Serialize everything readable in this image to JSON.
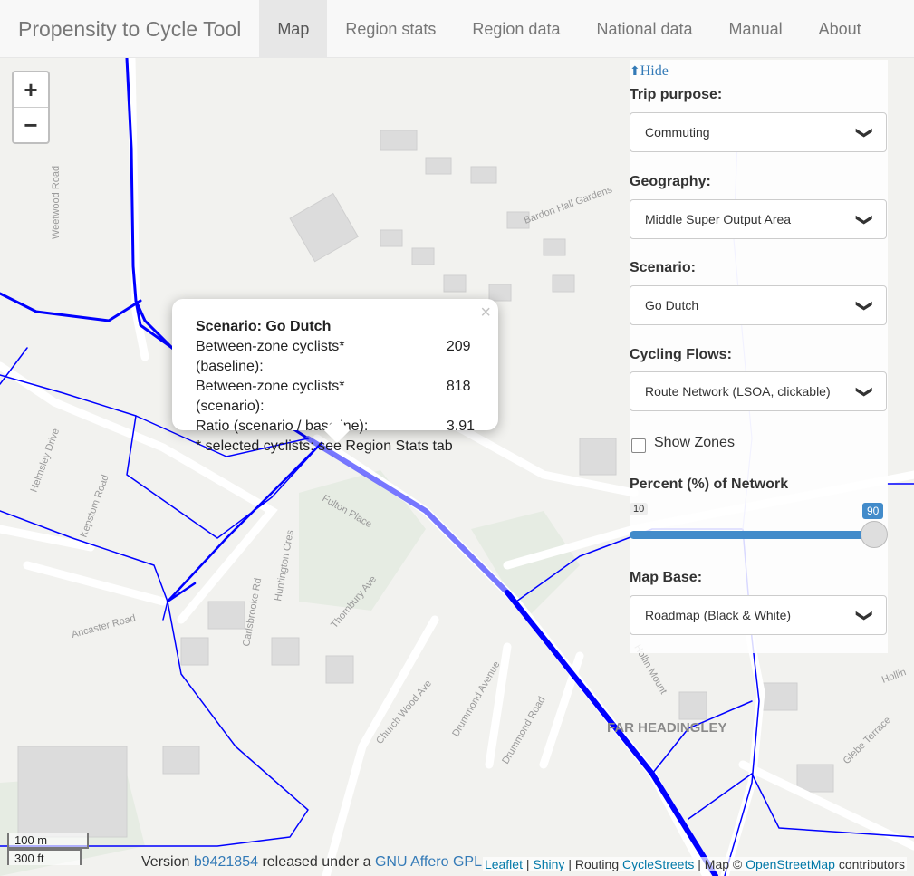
{
  "brand": "Propensity to Cycle Tool",
  "nav": [
    "Map",
    "Region stats",
    "Region data",
    "National data",
    "Manual",
    "About"
  ],
  "zoom": {
    "in": "+",
    "out": "−"
  },
  "map_labels": [
    "Bardon Hall Gardens",
    "Fulton Place",
    "Huntington Cres",
    "Thornbury Ave",
    "Ancaster Road",
    "Church Wood Ave",
    "Drummond Avenue",
    "Drummond Road",
    "Hollin Mount",
    "FAR HEADINGLEY",
    "Glebe Terrace",
    "Weetwood Road",
    "Kepstom Road",
    "Carlsbrooke Rd",
    "Helmsley Drive",
    "Hollin"
  ],
  "popup": {
    "title": "Scenario: Go Dutch",
    "rows": [
      {
        "label": "Between-zone cyclists* (baseline):",
        "value": "209"
      },
      {
        "label": "Between-zone cyclists* (scenario):",
        "value": "818"
      },
      {
        "label": "Ratio (scenario / baseline):",
        "value": "3.91"
      }
    ],
    "note": "* selected cyclists: see Region Stats tab",
    "close": "×"
  },
  "panel": {
    "hide": "Hide",
    "trip_label": "Trip purpose:",
    "trip_value": "Commuting",
    "geo_label": "Geography:",
    "geo_value": "Middle Super Output Area",
    "scenario_label": "Scenario:",
    "scenario_value": "Go Dutch",
    "flows_label": "Cycling Flows:",
    "flows_value": "Route Network (LSOA, clickable)",
    "zones_label": "Show Zones",
    "zones_checked": false,
    "percent_label": "Percent (%) of Network",
    "slider_min": "10",
    "slider_max": "90",
    "slider_value": 90,
    "mapbase_label": "Map Base:",
    "mapbase_value": "Roadmap (Black & White)"
  },
  "scale": {
    "m": "100 m",
    "ft": "300 ft"
  },
  "version": {
    "prefix": "Version ",
    "hash": "b9421854",
    "mid": " released under a ",
    "license": "GNU Affero GPL"
  },
  "attribution": {
    "leaflet": "Leaflet",
    "sep1": " | ",
    "shiny": "Shiny",
    "routing": " | Routing ",
    "cyclestreets": "CycleStreets",
    "map": " | Map © ",
    "osm": "OpenStreetMap",
    "contrib": " contributors"
  },
  "colors": {
    "route": "#0000ff",
    "accent": "#428bca",
    "link": "#337ab7"
  }
}
